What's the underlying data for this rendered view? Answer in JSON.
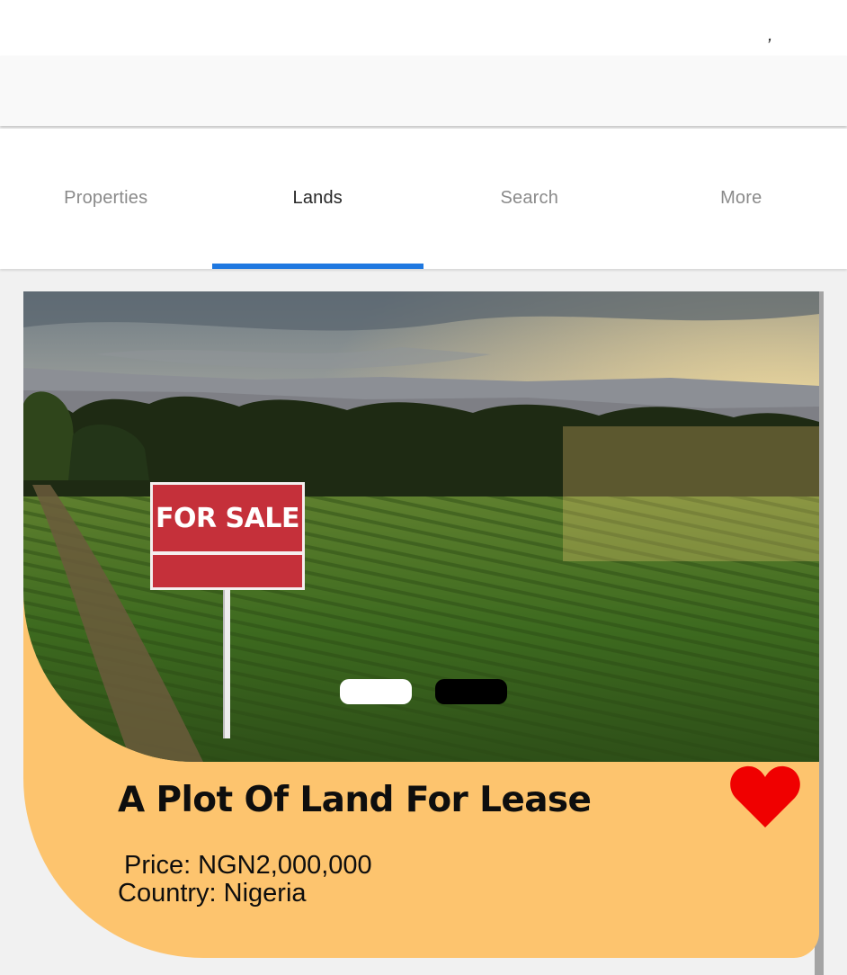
{
  "status_bar": {
    "mark": ","
  },
  "tabs": [
    {
      "label": "Properties",
      "active": false
    },
    {
      "label": "Lands",
      "active": true
    },
    {
      "label": "Search",
      "active": false
    },
    {
      "label": "More",
      "active": false
    }
  ],
  "accent_color": "#1f78e0",
  "listing": {
    "image_sign_text": "FOR SALE",
    "carousel": {
      "total": 2,
      "current": 1
    },
    "title": "A Plot Of Land For Lease",
    "price": "Price: NGN2,000,000",
    "country": "Country: Nigeria",
    "favorite": true,
    "favorite_icon": "heart-icon",
    "favorite_color": "#f00000",
    "card_color": "#fdc46e"
  }
}
